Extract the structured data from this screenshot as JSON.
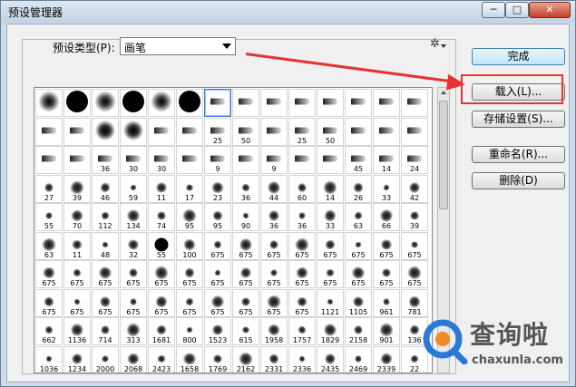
{
  "window": {
    "title": "预设管理器",
    "controls": {
      "minimize": "─",
      "maximize": "□",
      "close": "✕"
    }
  },
  "preset_type": {
    "label": "预设类型(P):",
    "value": "画笔"
  },
  "buttons": {
    "done": "完成",
    "load": "载入(L)...",
    "save": "存储设置(S)...",
    "rename": "重命名(R)...",
    "delete": "删除(D)"
  },
  "brush_rows": [
    [
      "",
      "",
      "",
      "",
      "",
      "",
      "",
      "",
      "",
      "",
      "",
      "",
      "",
      ""
    ],
    [
      "",
      "",
      "",
      "",
      "",
      "",
      "25",
      "50",
      "",
      "25",
      "50",
      "",
      "",
      ""
    ],
    [
      "",
      "",
      "36",
      "30",
      "30",
      "",
      "9",
      "",
      "9",
      "",
      "",
      "45",
      "14",
      "24"
    ],
    [
      "27",
      "39",
      "46",
      "59",
      "11",
      "17",
      "23",
      "36",
      "44",
      "60",
      "14",
      "26",
      "33",
      "42"
    ],
    [
      "55",
      "70",
      "112",
      "134",
      "74",
      "95",
      "95",
      "90",
      "36",
      "36",
      "33",
      "63",
      "66",
      "39"
    ],
    [
      "63",
      "11",
      "48",
      "32",
      "55",
      "100",
      "675",
      "675",
      "675",
      "675",
      "675",
      "675",
      "675",
      "675"
    ],
    [
      "675",
      "675",
      "675",
      "675",
      "675",
      "675",
      "675",
      "675",
      "675",
      "675",
      "675",
      "675",
      "675",
      "675"
    ],
    [
      "675",
      "675",
      "675",
      "675",
      "675",
      "675",
      "675",
      "675",
      "675",
      "675",
      "1121",
      "1105",
      "961",
      "781"
    ],
    [
      "662",
      "1136",
      "714",
      "313",
      "1681",
      "800",
      "1523",
      "615",
      "1958",
      "1757",
      "1829",
      "2158",
      "901",
      "136"
    ],
    [
      "1036",
      "1234",
      "2000",
      "2068",
      "2423",
      "1658",
      "1769",
      "2162",
      "2331",
      "2336",
      "2435",
      "2469",
      "2339",
      "22"
    ]
  ],
  "watermark": {
    "text": "查询啦",
    "url": "chaxunla.com"
  },
  "colors": {
    "accent": "#3b7ad9",
    "annotation": "#e63232"
  }
}
